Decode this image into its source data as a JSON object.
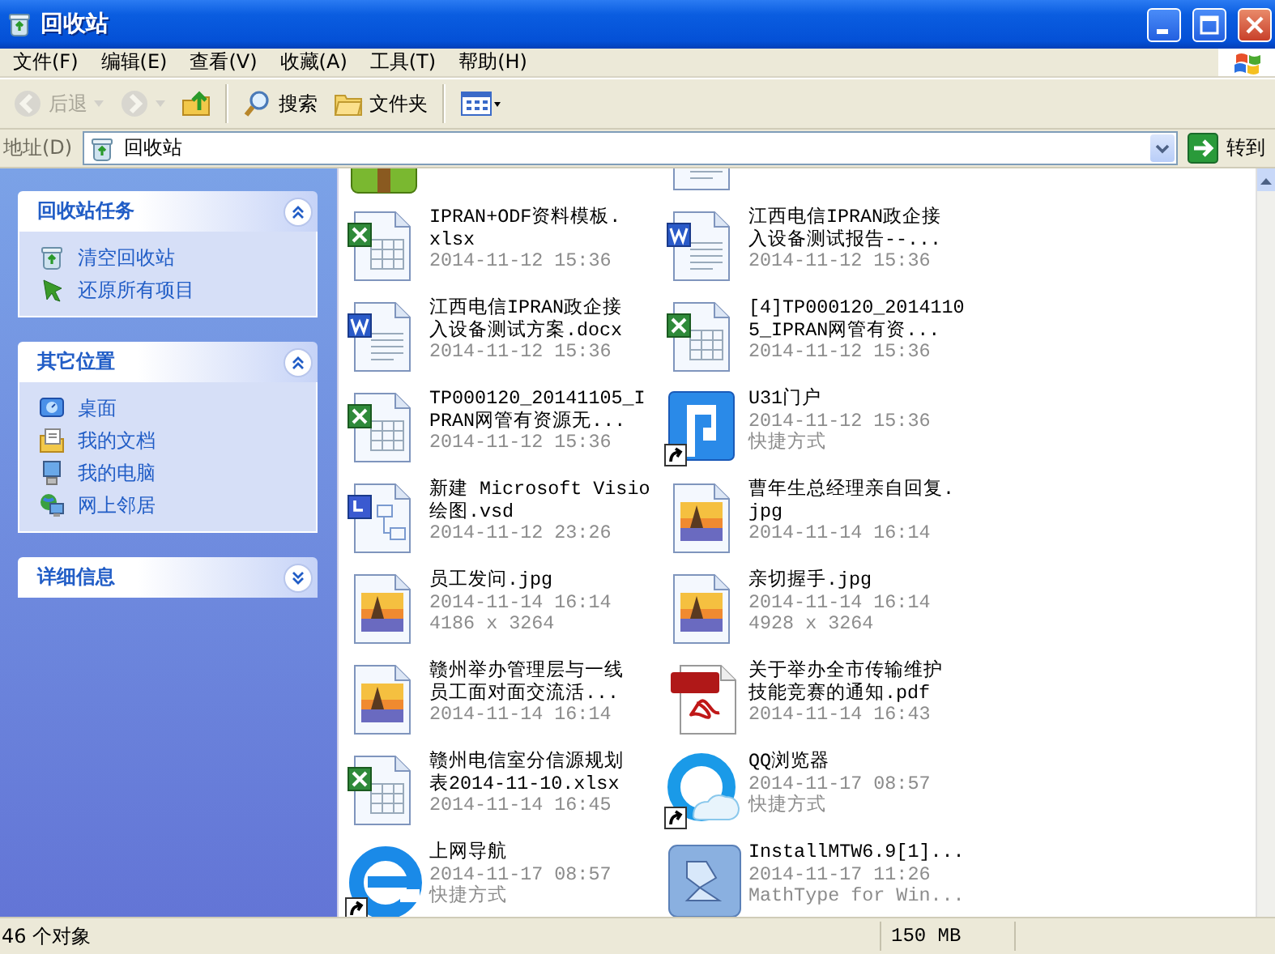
{
  "window": {
    "title": "回收站"
  },
  "menu": [
    "文件(F)",
    "编辑(E)",
    "查看(V)",
    "收藏(A)",
    "工具(T)",
    "帮助(H)"
  ],
  "toolbar": {
    "buttons": [
      {
        "kind": "back",
        "label": "后退",
        "disabled": true
      },
      {
        "kind": "forward",
        "disabled": true
      },
      {
        "kind": "up",
        "disabled": false
      },
      {
        "kind": "search",
        "label": "搜索",
        "disabled": false
      },
      {
        "kind": "folders",
        "label": "文件夹",
        "disabled": false
      },
      {
        "kind": "views",
        "disabled": false
      }
    ]
  },
  "address": {
    "label": "地址(D)",
    "value": "回收站",
    "go": "转到"
  },
  "sidebar": {
    "panels": [
      {
        "title": "回收站任务",
        "expanded": true,
        "items": [
          {
            "kind": "empty",
            "label": "清空回收站"
          },
          {
            "kind": "restore",
            "label": "还原所有项目"
          }
        ]
      },
      {
        "title": "其它位置",
        "expanded": true,
        "items": [
          {
            "kind": "desktop",
            "label": "桌面"
          },
          {
            "kind": "documents",
            "label": "我的文档"
          },
          {
            "kind": "computer",
            "label": "我的电脑"
          },
          {
            "kind": "network",
            "label": "网上邻居"
          }
        ]
      },
      {
        "title": "详细信息",
        "expanded": false
      }
    ]
  },
  "files": [
    {
      "kind": "archive",
      "shortcut": false
    },
    {
      "kind": "word",
      "shortcut": false
    },
    {
      "kind": "excel",
      "shortcut": false,
      "lines": [
        "IPRAN+ODF资料模板.",
        "xlsx"
      ],
      "details": [
        "2014-11-12 15:36"
      ]
    },
    {
      "kind": "word",
      "shortcut": false,
      "lines": [
        "江西电信IPRAN政企接",
        "入设备测试报告--..."
      ],
      "details": [
        "2014-11-12 15:36"
      ]
    },
    {
      "kind": "word",
      "shortcut": false,
      "lines": [
        "江西电信IPRAN政企接",
        "入设备测试方案.docx"
      ],
      "details": [
        "2014-11-12 15:36"
      ]
    },
    {
      "kind": "excel",
      "shortcut": false,
      "lines": [
        "[4]TP000120_2014110",
        "5_IPRAN网管有资..."
      ],
      "details": [
        "2014-11-12 15:36"
      ]
    },
    {
      "kind": "excel",
      "shortcut": false,
      "lines": [
        "TP000120_20141105_I",
        "PRAN网管有资源无..."
      ],
      "details": [
        "2014-11-12 15:36"
      ]
    },
    {
      "kind": "app",
      "shortcut": true,
      "lines": [
        "U31门户"
      ],
      "details": [
        "2014-11-12 15:36",
        "快捷方式"
      ]
    },
    {
      "kind": "visio",
      "shortcut": false,
      "lines": [
        "新建 Microsoft Visio",
        "绘图.vsd"
      ],
      "details": [
        "2014-11-12 23:26"
      ]
    },
    {
      "kind": "image",
      "shortcut": false,
      "lines": [
        "曹年生总经理亲自回复.",
        "jpg"
      ],
      "details": [
        "2014-11-14 16:14"
      ]
    },
    {
      "kind": "image",
      "shortcut": false,
      "lines": [
        "员工发问.jpg"
      ],
      "details": [
        "2014-11-14 16:14",
        "4186 x 3264"
      ]
    },
    {
      "kind": "image",
      "shortcut": false,
      "lines": [
        "亲切握手.jpg"
      ],
      "details": [
        "2014-11-14 16:14",
        "4928 x 3264"
      ]
    },
    {
      "kind": "image",
      "shortcut": false,
      "lines": [
        "赣州举办管理层与一线",
        "员工面对面交流活..."
      ],
      "details": [
        "2014-11-14 16:14"
      ]
    },
    {
      "kind": "pdf",
      "shortcut": false,
      "lines": [
        "关于举办全市传输维护",
        "技能竞赛的通知.pdf"
      ],
      "details": [
        "2014-11-14 16:43"
      ]
    },
    {
      "kind": "excel",
      "shortcut": false,
      "lines": [
        "赣州电信室分信源规划",
        "表2014-11-10.xlsx"
      ],
      "details": [
        "2014-11-14 16:45"
      ]
    },
    {
      "kind": "browser",
      "shortcut": true,
      "lines": [
        "QQ浏览器"
      ],
      "details": [
        "2014-11-17 08:57",
        "快捷方式"
      ]
    },
    {
      "kind": "ie",
      "shortcut": true,
      "lines": [
        "上网导航"
      ],
      "details": [
        "2014-11-17 08:57",
        "快捷方式"
      ]
    },
    {
      "kind": "installer",
      "shortcut": false,
      "lines": [
        "InstallMTW6.9[1]..."
      ],
      "details": [
        "2014-11-17 11:26",
        "MathType for Win..."
      ]
    }
  ],
  "status_bar": {
    "count": "46 个对象",
    "size": "150 MB"
  }
}
